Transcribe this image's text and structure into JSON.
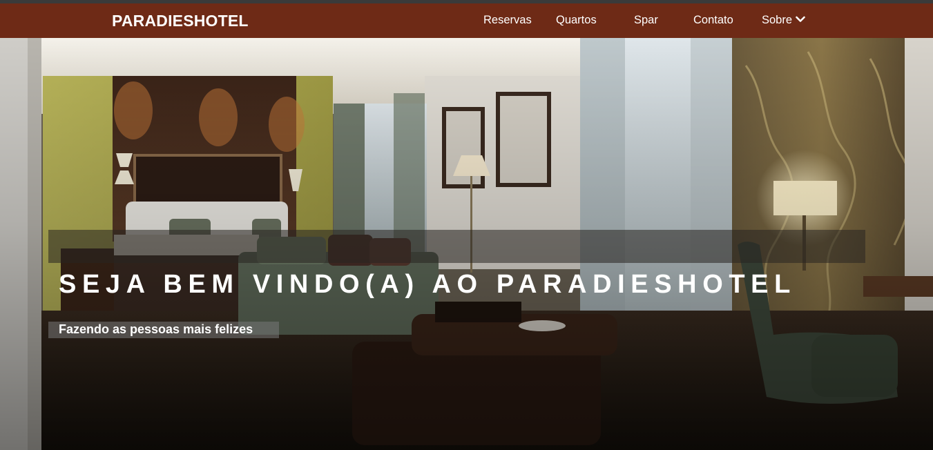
{
  "brand": "PARADIESHOTEL",
  "nav": {
    "items": [
      {
        "label": "Reservas"
      },
      {
        "label": "Quartos"
      },
      {
        "label": "Spar"
      },
      {
        "label": "Contato"
      },
      {
        "label": "Sobre"
      }
    ]
  },
  "hero": {
    "headline": "SEJA BEM VINDO(A) AO PARADIESHOTEL",
    "subtitle": "Fazendo as pessoas mais felizes"
  },
  "colors": {
    "navbar": "#6e2a16",
    "text": "#ffffff"
  },
  "icons": {
    "sobre_dropdown": "chevron-down-icon"
  }
}
